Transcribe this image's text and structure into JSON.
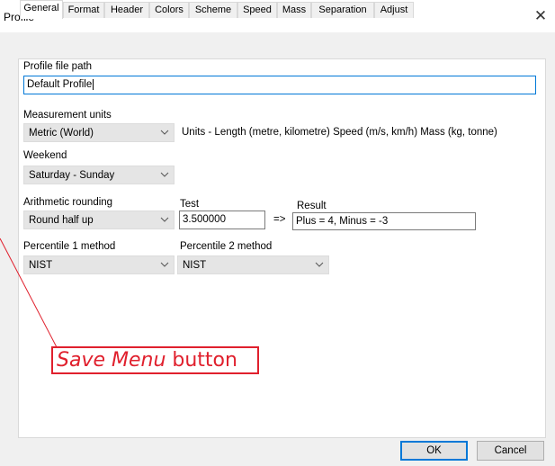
{
  "window": {
    "title": "Profile"
  },
  "tabs": [
    {
      "label": "General",
      "active": true
    },
    {
      "label": "Format"
    },
    {
      "label": "Header"
    },
    {
      "label": "Colors"
    },
    {
      "label": "Scheme"
    },
    {
      "label": "Speed"
    },
    {
      "label": "Mass"
    },
    {
      "label": "Separation"
    },
    {
      "label": "Adjust"
    }
  ],
  "general": {
    "profile_path": {
      "label": "Profile file path",
      "value": "Default Profile"
    },
    "measurement_units": {
      "label": "Measurement units",
      "selected": "Metric (World)",
      "description": "Units - Length (metre, kilometre) Speed (m/s, km/h) Mass (kg, tonne)"
    },
    "weekend": {
      "label": "Weekend",
      "selected": "Saturday - Sunday"
    },
    "rounding": {
      "label": "Arithmetic rounding",
      "selected": "Round half up",
      "test_label": "Test",
      "test_value": "3.500000",
      "arrow": "=>",
      "result_label": "Result",
      "result_value": "Plus = 4, Minus = -3"
    },
    "percentile1": {
      "label": "Percentile 1 method",
      "selected": "NIST"
    },
    "percentile2": {
      "label": "Percentile 2 method",
      "selected": "NIST"
    }
  },
  "buttons": {
    "ok": "OK",
    "cancel": "Cancel"
  },
  "annotation": {
    "emphasis": "Save Menu",
    "rest": " button",
    "color": "#e0202d"
  },
  "icons": {
    "close": "close-icon",
    "dropdown": "chevron-down-icon"
  },
  "colors": {
    "focus_border": "#0078d7",
    "combo_bg": "#e5e5e5",
    "dialog_bg": "#f0f0f0"
  }
}
